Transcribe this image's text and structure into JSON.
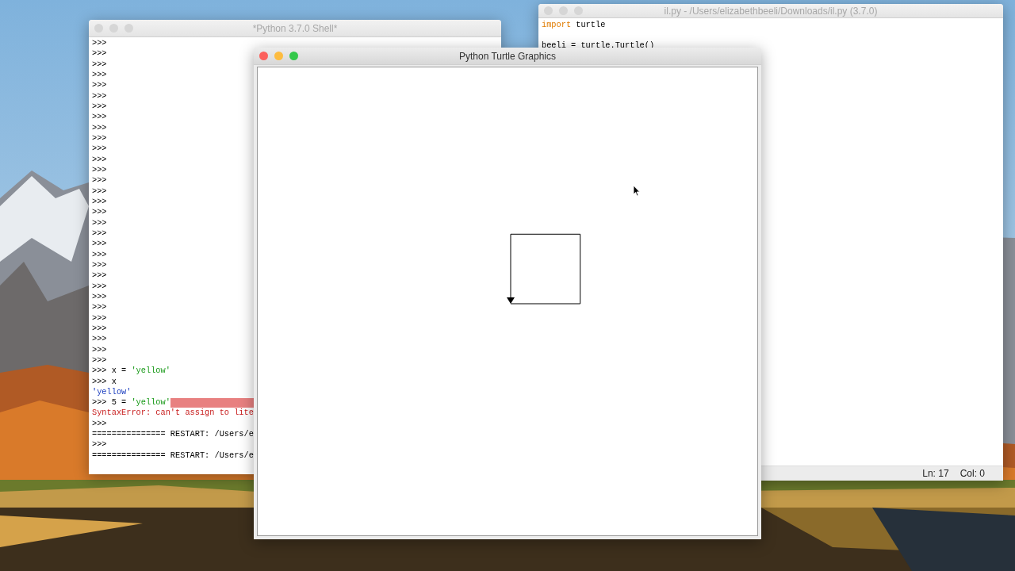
{
  "shell_window": {
    "title": "*Python 3.7.0 Shell*",
    "active": false,
    "lines": [
      {
        "segments": [
          {
            "kind": "code",
            "text": ">>>"
          }
        ]
      },
      {
        "segments": [
          {
            "kind": "code",
            "text": ">>>"
          }
        ]
      },
      {
        "segments": [
          {
            "kind": "code",
            "text": ">>>"
          }
        ]
      },
      {
        "segments": [
          {
            "kind": "code",
            "text": ">>>"
          }
        ]
      },
      {
        "segments": [
          {
            "kind": "code",
            "text": ">>>"
          }
        ]
      },
      {
        "segments": [
          {
            "kind": "code",
            "text": ">>>"
          }
        ]
      },
      {
        "segments": [
          {
            "kind": "code",
            "text": ">>>"
          }
        ]
      },
      {
        "segments": [
          {
            "kind": "code",
            "text": ">>>"
          }
        ]
      },
      {
        "segments": [
          {
            "kind": "code",
            "text": ">>>"
          }
        ]
      },
      {
        "segments": [
          {
            "kind": "code",
            "text": ">>>"
          }
        ]
      },
      {
        "segments": [
          {
            "kind": "code",
            "text": ">>>"
          }
        ]
      },
      {
        "segments": [
          {
            "kind": "code",
            "text": ">>>"
          }
        ]
      },
      {
        "segments": [
          {
            "kind": "code",
            "text": ">>>"
          }
        ]
      },
      {
        "segments": [
          {
            "kind": "code",
            "text": ">>>"
          }
        ]
      },
      {
        "segments": [
          {
            "kind": "code",
            "text": ">>>"
          }
        ]
      },
      {
        "segments": [
          {
            "kind": "code",
            "text": ">>>"
          }
        ]
      },
      {
        "segments": [
          {
            "kind": "code",
            "text": ">>>"
          }
        ]
      },
      {
        "segments": [
          {
            "kind": "code",
            "text": ">>>"
          }
        ]
      },
      {
        "segments": [
          {
            "kind": "code",
            "text": ">>>"
          }
        ]
      },
      {
        "segments": [
          {
            "kind": "code",
            "text": ">>>"
          }
        ]
      },
      {
        "segments": [
          {
            "kind": "code",
            "text": ">>>"
          }
        ]
      },
      {
        "segments": [
          {
            "kind": "code",
            "text": ">>>"
          }
        ]
      },
      {
        "segments": [
          {
            "kind": "code",
            "text": ">>>"
          }
        ]
      },
      {
        "segments": [
          {
            "kind": "code",
            "text": ">>>"
          }
        ]
      },
      {
        "segments": [
          {
            "kind": "code",
            "text": ">>>"
          }
        ]
      },
      {
        "segments": [
          {
            "kind": "code",
            "text": ">>>"
          }
        ]
      },
      {
        "segments": [
          {
            "kind": "code",
            "text": ">>>"
          }
        ]
      },
      {
        "segments": [
          {
            "kind": "code",
            "text": ">>>"
          }
        ]
      },
      {
        "segments": [
          {
            "kind": "code",
            "text": ">>>"
          }
        ]
      },
      {
        "segments": [
          {
            "kind": "code",
            "text": ">>>"
          }
        ]
      },
      {
        "segments": [
          {
            "kind": "code",
            "text": ">>>"
          }
        ]
      },
      {
        "segments": [
          {
            "kind": "code",
            "text": ">>> x = "
          },
          {
            "kind": "string",
            "text": "'yellow'"
          }
        ]
      },
      {
        "segments": [
          {
            "kind": "code",
            "text": ">>> x"
          }
        ]
      },
      {
        "segments": [
          {
            "kind": "output",
            "text": "'yellow'"
          }
        ]
      },
      {
        "segments": [
          {
            "kind": "code",
            "text": ">>> 5 = "
          },
          {
            "kind": "string",
            "text": "'yellow'"
          }
        ],
        "error_highlight": true
      },
      {
        "segments": [
          {
            "kind": "error",
            "text": "SyntaxError: can't assign to lite"
          }
        ]
      },
      {
        "segments": [
          {
            "kind": "code",
            "text": ">>>"
          }
        ]
      },
      {
        "segments": [
          {
            "kind": "code",
            "text": "=============== RESTART: /Users/e"
          }
        ]
      },
      {
        "segments": [
          {
            "kind": "code",
            "text": ">>>"
          }
        ]
      },
      {
        "segments": [
          {
            "kind": "code",
            "text": "=============== RESTART: /Users/e"
          }
        ]
      }
    ]
  },
  "editor_window": {
    "title": "il.py - /Users/elizabethbeeli/Downloads/il.py (3.7.0)",
    "active": false,
    "lines": [
      {
        "segments": [
          {
            "kind": "keyword",
            "text": "import"
          },
          {
            "kind": "code",
            "text": " turtle"
          }
        ],
        "blank_before": false
      },
      {
        "segments": [
          {
            "kind": "code",
            "text": "beeli = turtle.Turtle()"
          }
        ],
        "blank_before": true
      }
    ],
    "status_bar": {
      "line": "Ln: 17",
      "column": "Col: 0"
    }
  },
  "turtle_window": {
    "title": "Python Turtle Graphics",
    "active": true
  }
}
